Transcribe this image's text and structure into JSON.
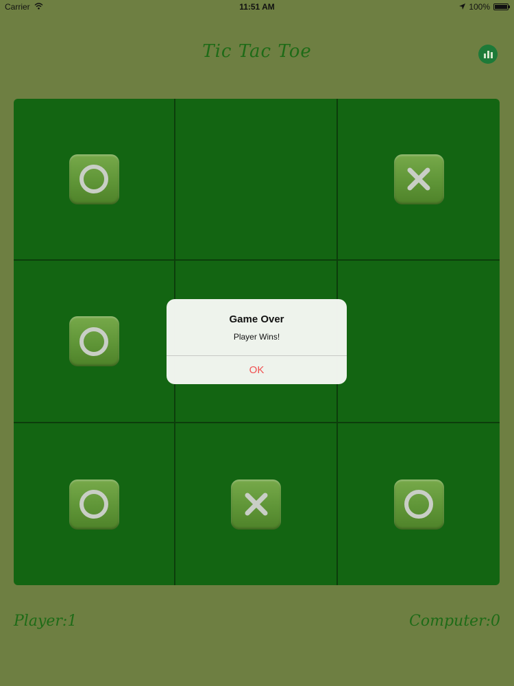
{
  "status_bar": {
    "carrier": "Carrier",
    "time": "11:51 AM",
    "battery": "100%"
  },
  "header": {
    "title": "Tic Tac Toe",
    "stats_icon": "bar-chart-icon"
  },
  "board": {
    "cells": [
      "O",
      "",
      "X",
      "O",
      "",
      "",
      "O",
      "X",
      "O"
    ]
  },
  "alert": {
    "title": "Game Over",
    "message": "Player Wins!",
    "ok_label": "OK"
  },
  "scores": {
    "player": "Player:1",
    "computer": "Computer:0"
  },
  "colors": {
    "background": "#6e7f42",
    "board": "#136512",
    "accent": "#1e6b17",
    "alert_button": "#f05050"
  }
}
